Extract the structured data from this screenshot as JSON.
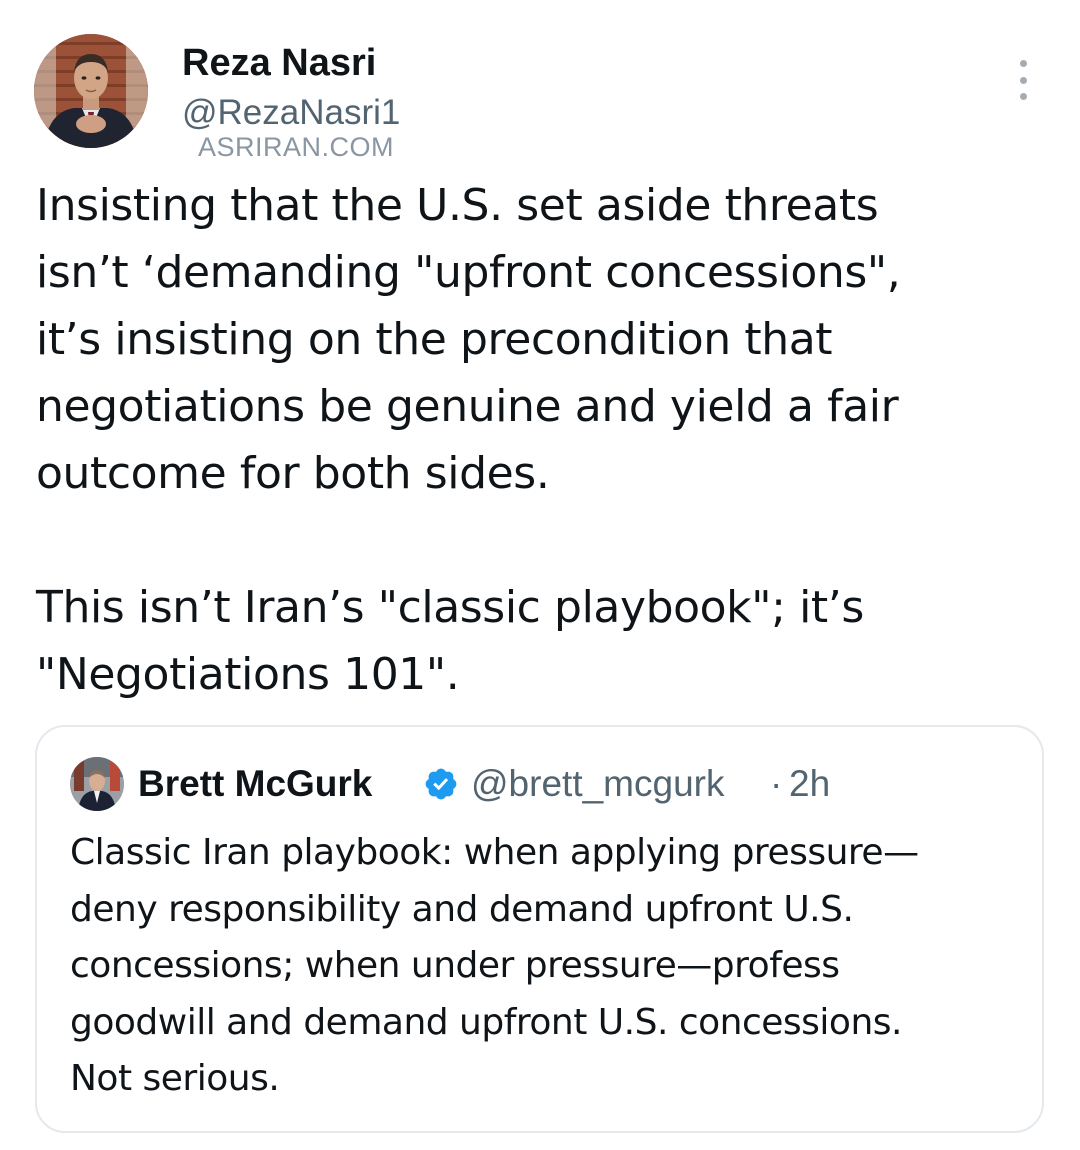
{
  "author": {
    "display_name": "Reza Nasri",
    "handle": "@RezaNasri1",
    "avatar_icon": "profile-photo"
  },
  "watermark": "ASRIRAN.COM",
  "more_icon": "more-options-icon",
  "tweet": {
    "paragraphs": [
      "Insisting that the U.S. set aside threats\nisn’t ‘demanding \"upfront concessions\",\nit’s insisting on the precondition that\nnegotiations be genuine and yield a fair\noutcome for both sides.",
      "This isn’t Iran’s \"classic playbook\"; it’s\n\"Negotiations 101\"."
    ]
  },
  "quoted_tweet": {
    "display_name": "Brett McGurk",
    "handle": "@brett_mcgurk",
    "separator": "·",
    "time": "2h",
    "verified": true,
    "text": "Classic Iran playbook: when applying pressure—\ndeny responsibility and demand upfront U.S.\nconcessions; when under pressure—profess\ngoodwill and demand upfront U.S. concessions.\nNot serious."
  },
  "colors": {
    "text_primary": "#0f1419",
    "text_secondary": "#536471",
    "verified_blue": "#1d9bf0",
    "border": "#e4e9ed"
  }
}
